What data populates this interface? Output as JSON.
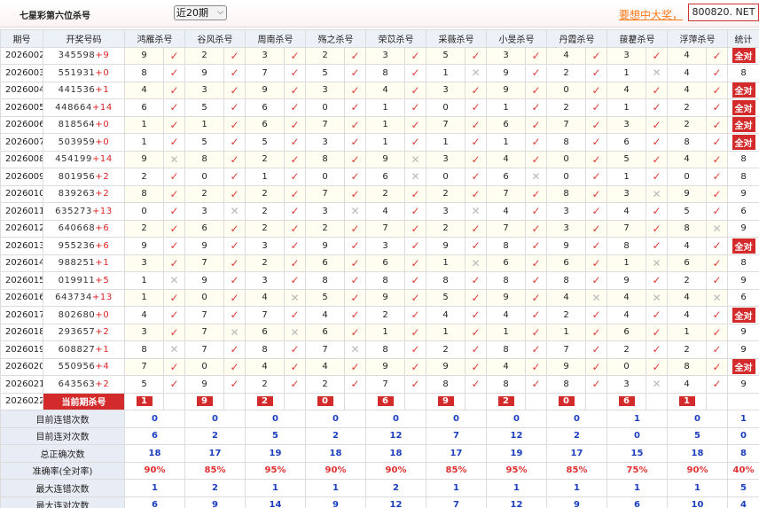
{
  "header": {
    "title": "七星彩第六位杀号",
    "range_select": "近20期",
    "promo": "要想中大奖，",
    "watermark": "800820. NET"
  },
  "columns": {
    "period": "期号",
    "draw": "开奖号码",
    "experts": [
      "鸿雁杀号",
      "谷风杀号",
      "周南杀号",
      "殇之杀号",
      "荣苡杀号",
      "采薇杀号",
      "小旻杀号",
      "丹霞杀号",
      "菝藋杀号",
      "浮萍杀号"
    ],
    "stat": "统计"
  },
  "rows": [
    {
      "period": "2026002",
      "draw": "345598",
      "extra": "+9",
      "kills": [
        9,
        2,
        3,
        2,
        3,
        5,
        3,
        4,
        3,
        4
      ],
      "marks": [
        1,
        1,
        1,
        1,
        1,
        1,
        1,
        1,
        1,
        1
      ],
      "stat": "全对"
    },
    {
      "period": "2026003",
      "draw": "551931",
      "extra": "+0",
      "kills": [
        8,
        9,
        7,
        5,
        8,
        1,
        9,
        2,
        1,
        4
      ],
      "marks": [
        1,
        1,
        1,
        1,
        1,
        0,
        1,
        1,
        0,
        1
      ],
      "stat": "8"
    },
    {
      "period": "2026004",
      "draw": "441536",
      "extra": "+1",
      "kills": [
        4,
        3,
        9,
        3,
        4,
        3,
        9,
        0,
        4,
        4
      ],
      "marks": [
        1,
        1,
        1,
        1,
        1,
        1,
        1,
        1,
        1,
        1
      ],
      "stat": "全对"
    },
    {
      "period": "2026005",
      "draw": "448664",
      "extra": "+14",
      "kills": [
        6,
        5,
        6,
        0,
        1,
        0,
        1,
        2,
        1,
        2
      ],
      "marks": [
        1,
        1,
        1,
        1,
        1,
        1,
        1,
        1,
        1,
        1
      ],
      "stat": "全对"
    },
    {
      "period": "2026006",
      "draw": "818564",
      "extra": "+0",
      "kills": [
        1,
        1,
        6,
        7,
        1,
        7,
        6,
        7,
        3,
        2
      ],
      "marks": [
        1,
        1,
        1,
        1,
        1,
        1,
        1,
        1,
        1,
        1
      ],
      "stat": "全对"
    },
    {
      "period": "2026007",
      "draw": "503959",
      "extra": "+0",
      "kills": [
        1,
        5,
        5,
        3,
        1,
        1,
        1,
        8,
        6,
        8
      ],
      "marks": [
        1,
        1,
        1,
        1,
        1,
        1,
        1,
        1,
        1,
        1
      ],
      "stat": "全对"
    },
    {
      "period": "2026008",
      "draw": "454199",
      "extra": "+14",
      "kills": [
        9,
        8,
        2,
        8,
        9,
        3,
        4,
        0,
        5,
        4
      ],
      "marks": [
        0,
        1,
        1,
        1,
        0,
        1,
        1,
        1,
        1,
        1
      ],
      "stat": "8"
    },
    {
      "period": "2026009",
      "draw": "801956",
      "extra": "+2",
      "kills": [
        2,
        0,
        1,
        0,
        6,
        0,
        6,
        0,
        1,
        0
      ],
      "marks": [
        1,
        1,
        1,
        1,
        0,
        1,
        0,
        1,
        1,
        1
      ],
      "stat": "8"
    },
    {
      "period": "2026010",
      "draw": "839263",
      "extra": "+2",
      "kills": [
        8,
        2,
        2,
        7,
        2,
        2,
        7,
        8,
        3,
        9
      ],
      "marks": [
        1,
        1,
        1,
        1,
        1,
        1,
        1,
        1,
        0,
        1
      ],
      "stat": "9"
    },
    {
      "period": "2026011",
      "draw": "635273",
      "extra": "+13",
      "kills": [
        0,
        3,
        2,
        3,
        4,
        3,
        4,
        3,
        4,
        5
      ],
      "marks": [
        1,
        0,
        1,
        0,
        1,
        0,
        1,
        1,
        1,
        1
      ],
      "stat": "6"
    },
    {
      "period": "2026012",
      "draw": "640668",
      "extra": "+6",
      "kills": [
        2,
        6,
        2,
        2,
        7,
        2,
        7,
        3,
        7,
        8
      ],
      "marks": [
        1,
        1,
        1,
        1,
        1,
        1,
        1,
        1,
        1,
        0
      ],
      "stat": "9"
    },
    {
      "period": "2026013",
      "draw": "955236",
      "extra": "+6",
      "kills": [
        9,
        9,
        3,
        9,
        3,
        9,
        8,
        9,
        8,
        4
      ],
      "marks": [
        1,
        1,
        1,
        1,
        1,
        1,
        1,
        1,
        1,
        1
      ],
      "stat": "全对"
    },
    {
      "period": "2026014",
      "draw": "988251",
      "extra": "+1",
      "kills": [
        3,
        7,
        2,
        6,
        6,
        1,
        6,
        6,
        1,
        6
      ],
      "marks": [
        1,
        1,
        1,
        1,
        1,
        0,
        1,
        1,
        0,
        1
      ],
      "stat": "8"
    },
    {
      "period": "2026015",
      "draw": "019911",
      "extra": "+5",
      "kills": [
        1,
        9,
        3,
        8,
        8,
        8,
        8,
        8,
        9,
        2
      ],
      "marks": [
        0,
        1,
        1,
        1,
        1,
        1,
        1,
        1,
        1,
        1
      ],
      "stat": "9"
    },
    {
      "period": "2026016",
      "draw": "643734",
      "extra": "+13",
      "kills": [
        1,
        0,
        4,
        5,
        9,
        5,
        9,
        4,
        4,
        4
      ],
      "marks": [
        1,
        1,
        0,
        1,
        1,
        1,
        1,
        0,
        0,
        0
      ],
      "stat": "6"
    },
    {
      "period": "2026017",
      "draw": "802680",
      "extra": "+0",
      "kills": [
        4,
        7,
        7,
        4,
        2,
        4,
        4,
        2,
        4,
        4
      ],
      "marks": [
        1,
        1,
        1,
        1,
        1,
        1,
        1,
        1,
        1,
        1
      ],
      "stat": "全对"
    },
    {
      "period": "2026018",
      "draw": "293657",
      "extra": "+2",
      "kills": [
        3,
        7,
        6,
        6,
        1,
        1,
        1,
        1,
        6,
        1
      ],
      "marks": [
        1,
        0,
        0,
        1,
        1,
        1,
        1,
        1,
        1,
        1
      ],
      "stat": "9"
    },
    {
      "period": "2026019",
      "draw": "608827",
      "extra": "+1",
      "kills": [
        8,
        7,
        8,
        7,
        8,
        2,
        8,
        7,
        2,
        2
      ],
      "marks": [
        0,
        1,
        1,
        0,
        1,
        1,
        1,
        1,
        1,
        1
      ],
      "stat": "9"
    },
    {
      "period": "2026020",
      "draw": "550956",
      "extra": "+4",
      "kills": [
        7,
        0,
        4,
        4,
        9,
        9,
        4,
        9,
        0,
        8
      ],
      "marks": [
        1,
        1,
        1,
        1,
        1,
        1,
        1,
        1,
        1,
        1
      ],
      "stat": "全对"
    },
    {
      "period": "2026021",
      "draw": "643563",
      "extra": "+2",
      "kills": [
        5,
        9,
        2,
        2,
        7,
        8,
        8,
        8,
        3,
        4
      ],
      "marks": [
        1,
        1,
        1,
        1,
        1,
        1,
        1,
        1,
        0,
        1
      ],
      "stat": "9"
    }
  ],
  "current": {
    "period": "2026022",
    "label": "当前期杀号",
    "kills": [
      "1",
      "9",
      "2",
      "0",
      "6",
      "9",
      "2",
      "0",
      "6",
      "1"
    ]
  },
  "stats": [
    {
      "label": "目前连错次数",
      "values": [
        "0",
        "0",
        "0",
        "0",
        "0",
        "0",
        "0",
        "0",
        "1",
        "0"
      ],
      "total": "1"
    },
    {
      "label": "目前连对次数",
      "values": [
        "6",
        "2",
        "5",
        "2",
        "12",
        "7",
        "12",
        "2",
        "0",
        "5"
      ],
      "total": "0"
    },
    {
      "label": "总正确次数",
      "values": [
        "18",
        "17",
        "19",
        "18",
        "18",
        "17",
        "19",
        "17",
        "15",
        "18"
      ],
      "total": "8"
    },
    {
      "label": "准确率(全对率)",
      "values": [
        "90%",
        "85%",
        "95%",
        "90%",
        "90%",
        "85%",
        "95%",
        "85%",
        "75%",
        "90%"
      ],
      "total": "40%"
    },
    {
      "label": "最大连错次数",
      "values": [
        "1",
        "2",
        "1",
        "1",
        "2",
        "1",
        "1",
        "1",
        "1",
        "1"
      ],
      "total": "5"
    },
    {
      "label": "最大连对次数",
      "values": [
        "6",
        "9",
        "14",
        "9",
        "12",
        "7",
        "12",
        "9",
        "6",
        "10"
      ],
      "total": "4"
    }
  ],
  "colors": {
    "accent_red": "#d32b2b",
    "stat_blue": "#1b3fbf",
    "header_bg": "#ecf0f7",
    "promo_orange": "#ff7a1a"
  },
  "icons": {
    "correct": "check-icon",
    "wrong": "cross-icon"
  }
}
